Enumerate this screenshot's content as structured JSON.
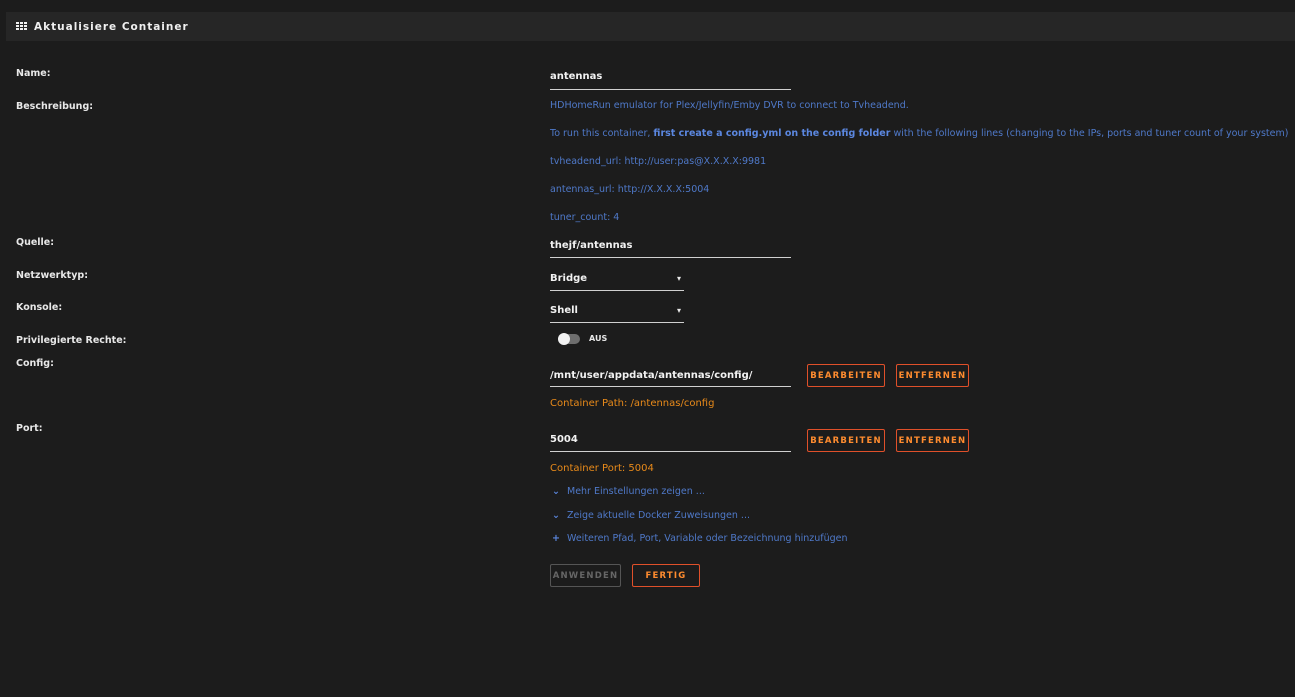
{
  "header": {
    "title": "Aktualisiere Container"
  },
  "labels": {
    "name": "Name:",
    "description": "Beschreibung:",
    "source": "Quelle:",
    "network": "Netzwerktyp:",
    "console": "Konsole:",
    "privileged": "Privilegierte Rechte:",
    "config": "Config:",
    "port": "Port:"
  },
  "fields": {
    "name": "antennas",
    "source": "thejf/antennas",
    "network": "Bridge",
    "console": "Shell",
    "config": "/mnt/user/appdata/antennas/config/",
    "port": "5004"
  },
  "description": {
    "line1": "HDHomeRun emulator for Plex/Jellyfin/Emby DVR to connect to Tvheadend.",
    "line2_pre": "To run this container, ",
    "line2_bold": "first create a config.yml on the config folder",
    "line2_post": " with the following lines (changing to the IPs, ports and tuner count of your system)",
    "line3": "tvheadend_url: http://user:pas@X.X.X.X:9981",
    "line4": "antennas_url: http://X.X.X.X:5004",
    "line5": "tuner_count: 4"
  },
  "privileged": {
    "state": "AUS"
  },
  "config": {
    "container_path": "Container Path: /antennas/config"
  },
  "port": {
    "container_port": "Container Port: 5004"
  },
  "buttons": {
    "edit": "BEARBEITEN",
    "remove": "ENTFERNEN",
    "apply": "ANWENDEN",
    "done": "FERTIG"
  },
  "links": {
    "more_settings": "Mehr Einstellungen zeigen ...",
    "show_docker": "Zeige aktuelle Docker Zuweisungen ...",
    "add_more": "Weiteren Pfad, Port, Variable oder Bezeichnung hinzufügen"
  },
  "colors": {
    "accent": "#e0502a",
    "link": "#4f79c9",
    "info": "#e88a1a"
  }
}
